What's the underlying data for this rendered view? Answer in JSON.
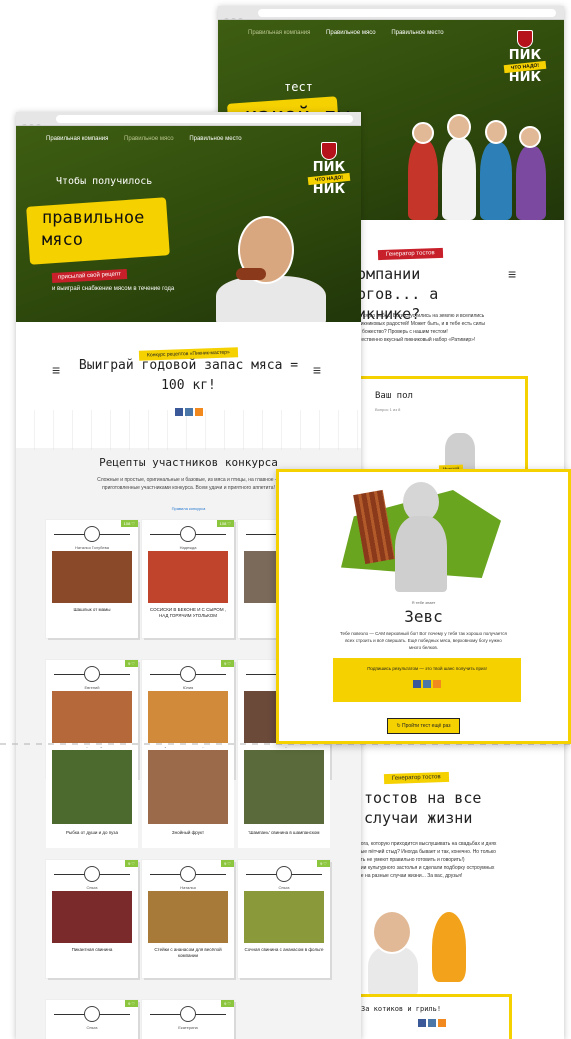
{
  "back_window": {
    "nav": [
      "Правильная компания",
      "Правильное мясо",
      "Правильное место"
    ],
    "hero_small": "тест",
    "hero_big": "какой ты",
    "logo": {
      "line1": "ПИК",
      "ribbon": "ЧТО НАДО!",
      "line2": "НИК"
    },
    "tag_red": "Генератор тостов",
    "title": "компании богов... а пикнике?",
    "desc_lines": [
      "ется до небес! Боги спустились на землю и вселились",
      "пикниковых радостей! Может быть, и в тебе есть силы",
      "ь божество? Проверь с нашим тестом!",
      "жественно вкусный пикниковый набор «Ратимир»!"
    ],
    "quiz": {
      "title": "Ваш пол",
      "subtitle": "Вопрос 1 из 8",
      "badge": "Мужской"
    },
    "tag_yellow2": "Генератор тостов",
    "toasts_title": "тостов на все случаи жизни",
    "toasts_desc": [
      "рога, которую приходится выслушивать на свадьбах и днях",
      "вые пётчий стыд? Иногда бывает и так, конечно. Но только",
      "сть не умеют правильно готовить и говорить!)",
      "ции культурного застолья и сделали подборку остроумных",
      "ие на разные случаи жизни... За вас, друзья!"
    ],
    "bottom_box": "За котиков и гриль!"
  },
  "front_window": {
    "nav": [
      "Правильная компания",
      "Правильное мясо",
      "Правильное место"
    ],
    "hero_small": "Чтобы получилось",
    "hero_big": [
      "правильное",
      "мясо"
    ],
    "ribbon": "присылай свой рецепт",
    "sub": "и выиграй снабжение мясом в течение года",
    "logo": {
      "line1": "ПИК",
      "ribbon": "ЧТО НАДО!",
      "line2": "НИК"
    },
    "tag": "Конкурс рецептов «Пикник-мастер»",
    "title": [
      "Выиграй годовой запас мяса =",
      "100 кг!"
    ],
    "recipes_title": "Рецепты участников конкурса",
    "recipes_desc": [
      "Сложные и простые, оригинальные и базовые, из мяса и птицы, на главное —",
      "приготовленные участниками конкурса. Всем удачи и приятного аппетита!"
    ],
    "rules_link": "Правила конкурса"
  },
  "cards": [
    {
      "author": "Наталья Голубева",
      "title": "Шашлык от мамы",
      "score": "108 ♡",
      "photo": "#8a4a2a"
    },
    {
      "author": "Надежда",
      "title": "СОСИСКИ В БЕКОНЕ И С СЫРОМ , НАД ГОРЯЧИМ УГОЛЬКОМ",
      "score": "108 ♡",
      "photo": "#c0442c"
    },
    {
      "author": "",
      "title": "У",
      "score": "",
      "photo": "#7b6a5a"
    },
    {
      "author": "Евгений",
      "title": "Шашлык вкусный. Одобрен друзьями!",
      "score": "9 ♡",
      "photo": "#b5683a"
    },
    {
      "author": "Юлия",
      "title": "Яблочно-пикниковый свин",
      "score": "9 ♡",
      "photo": "#d08a3a"
    },
    {
      "author": "",
      "title": "Шашлык по-китайски 'Кунжутная свинка'",
      "score": "",
      "photo": "#6b4a3a"
    },
    {
      "author": "",
      "title": "Рыбка от души и до пуза",
      "score": "",
      "photo": "#4d6a2e"
    },
    {
      "author": "",
      "title": "Знойный фрукт",
      "score": "",
      "photo": "#9a6a4a"
    },
    {
      "author": "",
      "title": "'Шампань' свинина в шампанском",
      "score": "",
      "photo": "#5a6a3a"
    },
    {
      "author": "Ольга",
      "title": "Пикантная свинина",
      "score": "9 ♡",
      "photo": "#7a2a2a"
    },
    {
      "author": "Наталья",
      "title": "Стейки с ананасом для весёлой компании",
      "score": "9 ♡",
      "photo": "#a87a3a"
    },
    {
      "author": "Ольга",
      "title": "Сочная свинина с ананасом в фольге",
      "score": "9 ♡",
      "photo": "#8a9a3a"
    },
    {
      "author": "Ольга",
      "title": "",
      "score": "9 ♡",
      "photo": ""
    },
    {
      "author": "Екатерина",
      "title": "",
      "score": "9 ♡",
      "photo": ""
    }
  ],
  "zeus": {
    "you": "Я тебе знает",
    "name": "Зевс",
    "desc": [
      "Тебе повезло — САМ верховный бог! Вот почему у тебя так хорошо получается",
      "всех строить и всё свершать. Ещё победных мяса, верховному богу нужно",
      "много белков."
    ],
    "share_text": "Подпишись результатом — это твой шанс получить приз!",
    "button": "Пройти тест ещё раз"
  },
  "colors": {
    "green": "#3e5e12",
    "yellow": "#f5d100",
    "red": "#c8202a"
  }
}
